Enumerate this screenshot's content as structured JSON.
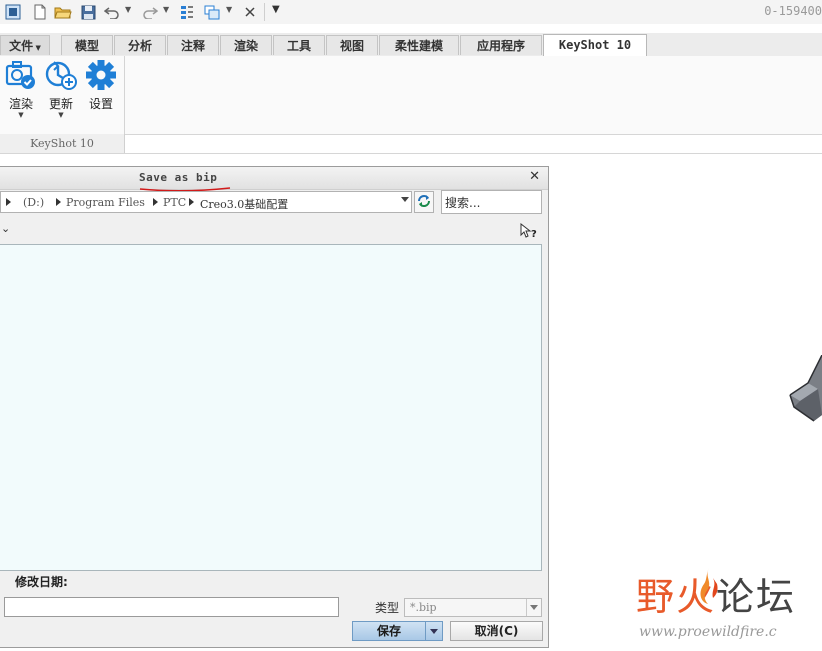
{
  "window": {
    "title_fragment": "0-159400"
  },
  "ribbon": {
    "tabs": [
      {
        "label": "文件"
      },
      {
        "label": "模型"
      },
      {
        "label": "分析"
      },
      {
        "label": "注释"
      },
      {
        "label": "渲染"
      },
      {
        "label": "工具"
      },
      {
        "label": "视图"
      },
      {
        "label": "柔性建模"
      },
      {
        "label": "应用程序"
      },
      {
        "label": "KeyShot 10",
        "active": true
      }
    ],
    "buttons": [
      {
        "label": "渲染",
        "icon": "render-camera-icon"
      },
      {
        "label": "更新",
        "icon": "update-icon"
      },
      {
        "label": "设置",
        "icon": "gear-icon"
      }
    ],
    "group_label": "KeyShot 10"
  },
  "dialog": {
    "title": "Save as bip",
    "path": {
      "segments": [
        "(D:)",
        "Program Files",
        "PTC",
        "Creo3.0基础配置"
      ]
    },
    "search_placeholder": "搜索...",
    "date_label": "修改日期:",
    "filename_value": "",
    "type_label": "类型",
    "type_value": "*.bip",
    "save_label": "保存",
    "cancel_label": "取消(C)"
  },
  "watermark": {
    "brand_part1": "野火",
    "brand_part2": "论坛",
    "url": "www.proewildfire.c"
  },
  "colors": {
    "accent_blue": "#1f7fd6",
    "underline_red": "#d11a1a",
    "file_list_bg": "#f2fbfc",
    "watermark_orange": "#e85a2a"
  }
}
